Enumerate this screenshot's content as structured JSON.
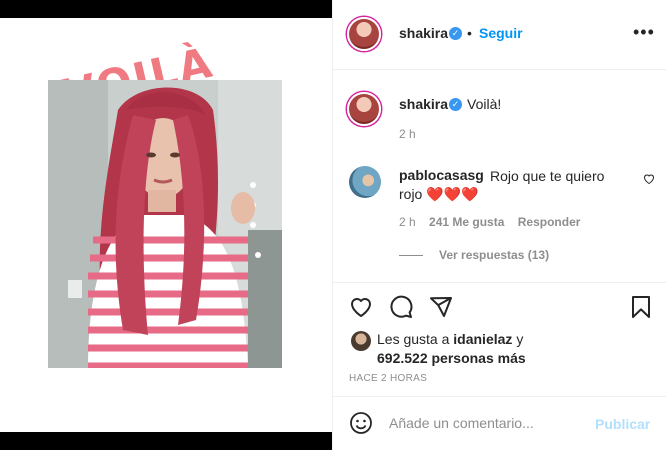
{
  "media": {
    "overlay_text": "VOILÀ"
  },
  "header": {
    "username": "shakira",
    "verified_mark": "✓",
    "separator": "•",
    "follow_label": "Seguir",
    "more_label": "•••"
  },
  "caption": {
    "username": "shakira",
    "verified_mark": "✓",
    "text": "Voilà!",
    "time": "2 h"
  },
  "comment": {
    "username": "pablocasasg",
    "text": "Rojo que te quiero rojo ❤️❤️❤️",
    "time": "2 h",
    "likes": "241 Me gusta",
    "reply_label": "Responder",
    "view_replies": "Ver respuestas (13)"
  },
  "likes": {
    "prefix": "Les gusta a",
    "user": "idanielaz",
    "conjunction": "y",
    "count": "692.522 personas más"
  },
  "posted": "HACE 2 HORAS",
  "composer": {
    "placeholder": "Añade un comentario...",
    "publish_label": "Publicar"
  },
  "icons": {
    "heart": "heart-icon",
    "comment": "comment-icon",
    "share": "share-icon",
    "save": "bookmark-icon",
    "emoji": "emoji-icon",
    "more": "more-icon"
  },
  "colors": {
    "accent": "#0095f6",
    "publish_disabled": "#b2dffc",
    "overlay_text": "#f07a82",
    "verified": "#3897f0"
  }
}
